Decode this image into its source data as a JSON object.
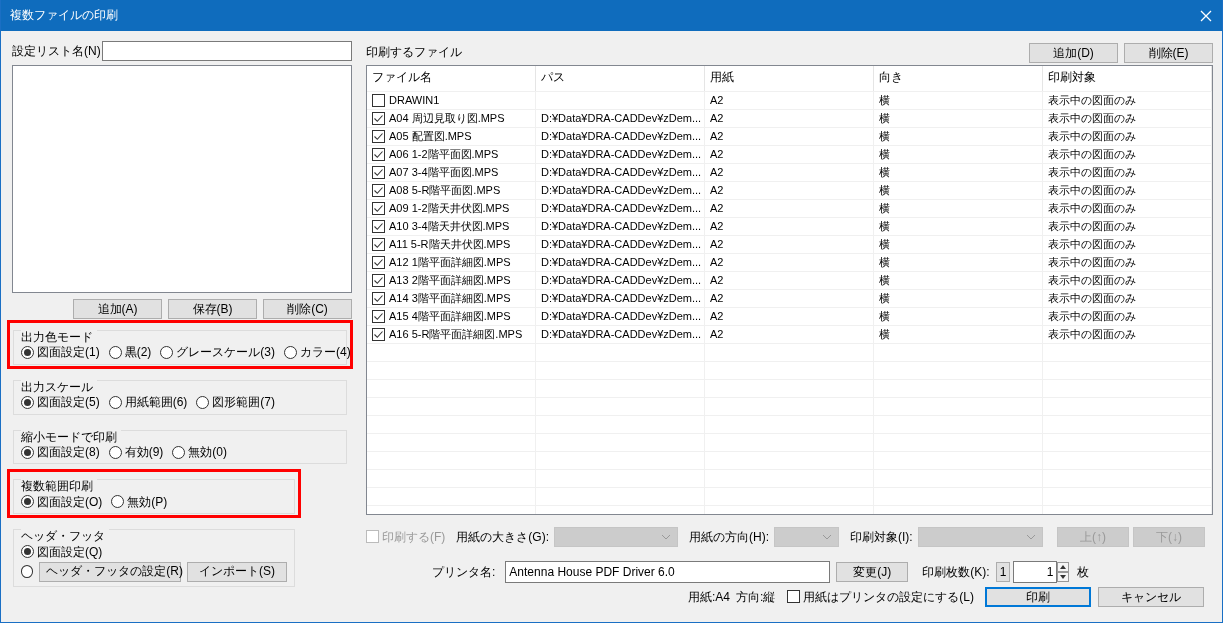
{
  "window": {
    "title": "複数ファイルの印刷"
  },
  "settings_list": {
    "label": "設定リスト名(N)",
    "buttons": [
      "追加(A)",
      "保存(B)",
      "削除(C)"
    ]
  },
  "option_groups": [
    {
      "title": "出力色モード",
      "highlighted": true,
      "options": [
        {
          "label": "図面設定(1)",
          "selected": true
        },
        {
          "label": "黒(2)",
          "selected": false
        },
        {
          "label": "グレースケール(3)",
          "selected": false
        },
        {
          "label": "カラー(4)",
          "selected": false
        }
      ]
    },
    {
      "title": "出力スケール",
      "highlighted": false,
      "options": [
        {
          "label": "図面設定(5)",
          "selected": true
        },
        {
          "label": "用紙範囲(6)",
          "selected": false
        },
        {
          "label": "図形範囲(7)",
          "selected": false
        }
      ]
    },
    {
      "title": "縮小モードで印刷",
      "highlighted": false,
      "options": [
        {
          "label": "図面設定(8)",
          "selected": true
        },
        {
          "label": "有効(9)",
          "selected": false
        },
        {
          "label": "無効(0)",
          "selected": false
        }
      ]
    },
    {
      "title": "複数範囲印刷",
      "highlighted": true,
      "options": [
        {
          "label": "図面設定(O)",
          "selected": true
        },
        {
          "label": "無効(P)",
          "selected": false
        }
      ]
    },
    {
      "title": "ヘッダ・フッタ",
      "highlighted": false,
      "options": [
        {
          "label": "図面設定(Q)",
          "selected": true
        },
        {
          "selected": false,
          "buttons": [
            "ヘッダ・フッタの設定(R)",
            "インポート(S)"
          ]
        }
      ]
    }
  ],
  "files": {
    "title": "印刷するファイル",
    "buttons": [
      "追加(D)",
      "削除(E)"
    ],
    "columns": [
      "ファイル名",
      "パス",
      "用紙",
      "向き",
      "印刷対象"
    ],
    "rows": [
      {
        "checked": false,
        "cells": [
          "DRAWIN1",
          "",
          "A2",
          "横",
          "表示中の図面のみ"
        ]
      },
      {
        "checked": true,
        "cells": [
          "A04 周辺見取り図.MPS",
          "D:¥Data¥DRA-CADDev¥zDem...",
          "A2",
          "横",
          "表示中の図面のみ"
        ]
      },
      {
        "checked": true,
        "cells": [
          "A05 配置図.MPS",
          "D:¥Data¥DRA-CADDev¥zDem...",
          "A2",
          "横",
          "表示中の図面のみ"
        ]
      },
      {
        "checked": true,
        "cells": [
          "A06 1-2階平面図.MPS",
          "D:¥Data¥DRA-CADDev¥zDem...",
          "A2",
          "横",
          "表示中の図面のみ"
        ]
      },
      {
        "checked": true,
        "cells": [
          "A07 3-4階平面図.MPS",
          "D:¥Data¥DRA-CADDev¥zDem...",
          "A2",
          "横",
          "表示中の図面のみ"
        ]
      },
      {
        "checked": true,
        "cells": [
          "A08 5-R階平面図.MPS",
          "D:¥Data¥DRA-CADDev¥zDem...",
          "A2",
          "横",
          "表示中の図面のみ"
        ]
      },
      {
        "checked": true,
        "cells": [
          "A09 1-2階天井伏図.MPS",
          "D:¥Data¥DRA-CADDev¥zDem...",
          "A2",
          "横",
          "表示中の図面のみ"
        ]
      },
      {
        "checked": true,
        "cells": [
          "A10 3-4階天井伏図.MPS",
          "D:¥Data¥DRA-CADDev¥zDem...",
          "A2",
          "横",
          "表示中の図面のみ"
        ]
      },
      {
        "checked": true,
        "cells": [
          "A11 5-R階天井伏図.MPS",
          "D:¥Data¥DRA-CADDev¥zDem...",
          "A2",
          "横",
          "表示中の図面のみ"
        ]
      },
      {
        "checked": true,
        "cells": [
          "A12 1階平面詳細図.MPS",
          "D:¥Data¥DRA-CADDev¥zDem...",
          "A2",
          "横",
          "表示中の図面のみ"
        ]
      },
      {
        "checked": true,
        "cells": [
          "A13 2階平面詳細図.MPS",
          "D:¥Data¥DRA-CADDev¥zDem...",
          "A2",
          "横",
          "表示中の図面のみ"
        ]
      },
      {
        "checked": true,
        "cells": [
          "A14 3階平面詳細図.MPS",
          "D:¥Data¥DRA-CADDev¥zDem...",
          "A2",
          "横",
          "表示中の図面のみ"
        ]
      },
      {
        "checked": true,
        "cells": [
          "A15 4階平面詳細図.MPS",
          "D:¥Data¥DRA-CADDev¥zDem...",
          "A2",
          "横",
          "表示中の図面のみ"
        ]
      },
      {
        "checked": true,
        "cells": [
          "A16 5-R階平面詳細図.MPS",
          "D:¥Data¥DRA-CADDev¥zDem...",
          "A2",
          "横",
          "表示中の図面のみ"
        ]
      }
    ]
  },
  "edit_bar": {
    "print_checkbox": {
      "label": "印刷する(F)",
      "checked": false,
      "disabled": true
    },
    "dropdowns": [
      {
        "label": "用紙の大きさ(G):",
        "disabled": true
      },
      {
        "label": "用紙の方向(H):",
        "disabled": true
      },
      {
        "label": "印刷対象(I):",
        "disabled": true
      }
    ],
    "buttons": [
      {
        "label": "上(↑)",
        "disabled": true
      },
      {
        "label": "下(↓)",
        "disabled": true
      }
    ]
  },
  "printer": {
    "label": "プリンタ名:",
    "value": "Antenna House PDF Driver 6.0",
    "change_button": "変更(J)",
    "copies_label": "印刷枚数(K):",
    "copies_min": "1",
    "copies": "1",
    "copies_unit": "枚"
  },
  "paper_info": {
    "paper": "用紙:A4",
    "orientation": "方向:縦"
  },
  "use_printer_paper": {
    "label": "用紙はプリンタの設定にする(L)",
    "checked": false
  },
  "dialog_buttons": [
    {
      "label": "印刷",
      "default": true
    },
    {
      "label": "キャンセル",
      "default": false
    }
  ]
}
